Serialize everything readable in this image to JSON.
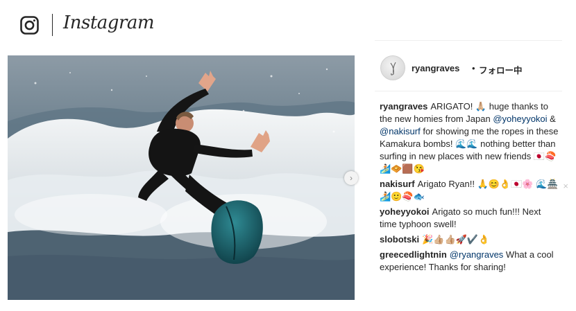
{
  "header": {
    "logo_icon": "instagram-camera-icon",
    "wordmark": "Instagram"
  },
  "post": {
    "author": "ryangraves",
    "dot": "•",
    "follow_status": "フォロー中",
    "photo_alt": "",
    "next_icon": "chevron-right-icon",
    "next_glyph": "›"
  },
  "comments": [
    {
      "user": "ryangraves",
      "parts": [
        {
          "t": "ARIGATO! 🙏🏼 huge thanks to the new homies from Japan "
        },
        {
          "m": "@yoheyyokoi"
        },
        {
          "t": " & "
        },
        {
          "m": "@nakisurf"
        },
        {
          "t": " for showing me the ropes in these Kamakura bombs! 🌊🌊 nothing better than surfing in new places with new friends 🇯🇵🍣🏄🏻🧇🟫😘"
        }
      ]
    },
    {
      "user": "nakisurf",
      "parts": [
        {
          "t": "Arigato Ryan!! 🙏😊👌🇯🇵🌸 🌊🏯🏄🏻🙂🍣🐟"
        }
      ],
      "has_delete": true,
      "delete_glyph": "×"
    },
    {
      "user": "yoheyyokoi",
      "parts": [
        {
          "t": "Arigato so much fun!!! Next time typhoon swell!"
        }
      ]
    },
    {
      "user": "slobotski",
      "parts": [
        {
          "t": "🎉👍🏼👍🏼🚀✔️👌"
        }
      ]
    },
    {
      "user": "greecedlightnin",
      "parts": [
        {
          "m": "@ryangraves"
        },
        {
          "t": " What a cool experience! Thanks for sharing!"
        }
      ]
    }
  ],
  "colors": {
    "text": "#262626",
    "mention": "#003569",
    "rule": "#efefef"
  }
}
